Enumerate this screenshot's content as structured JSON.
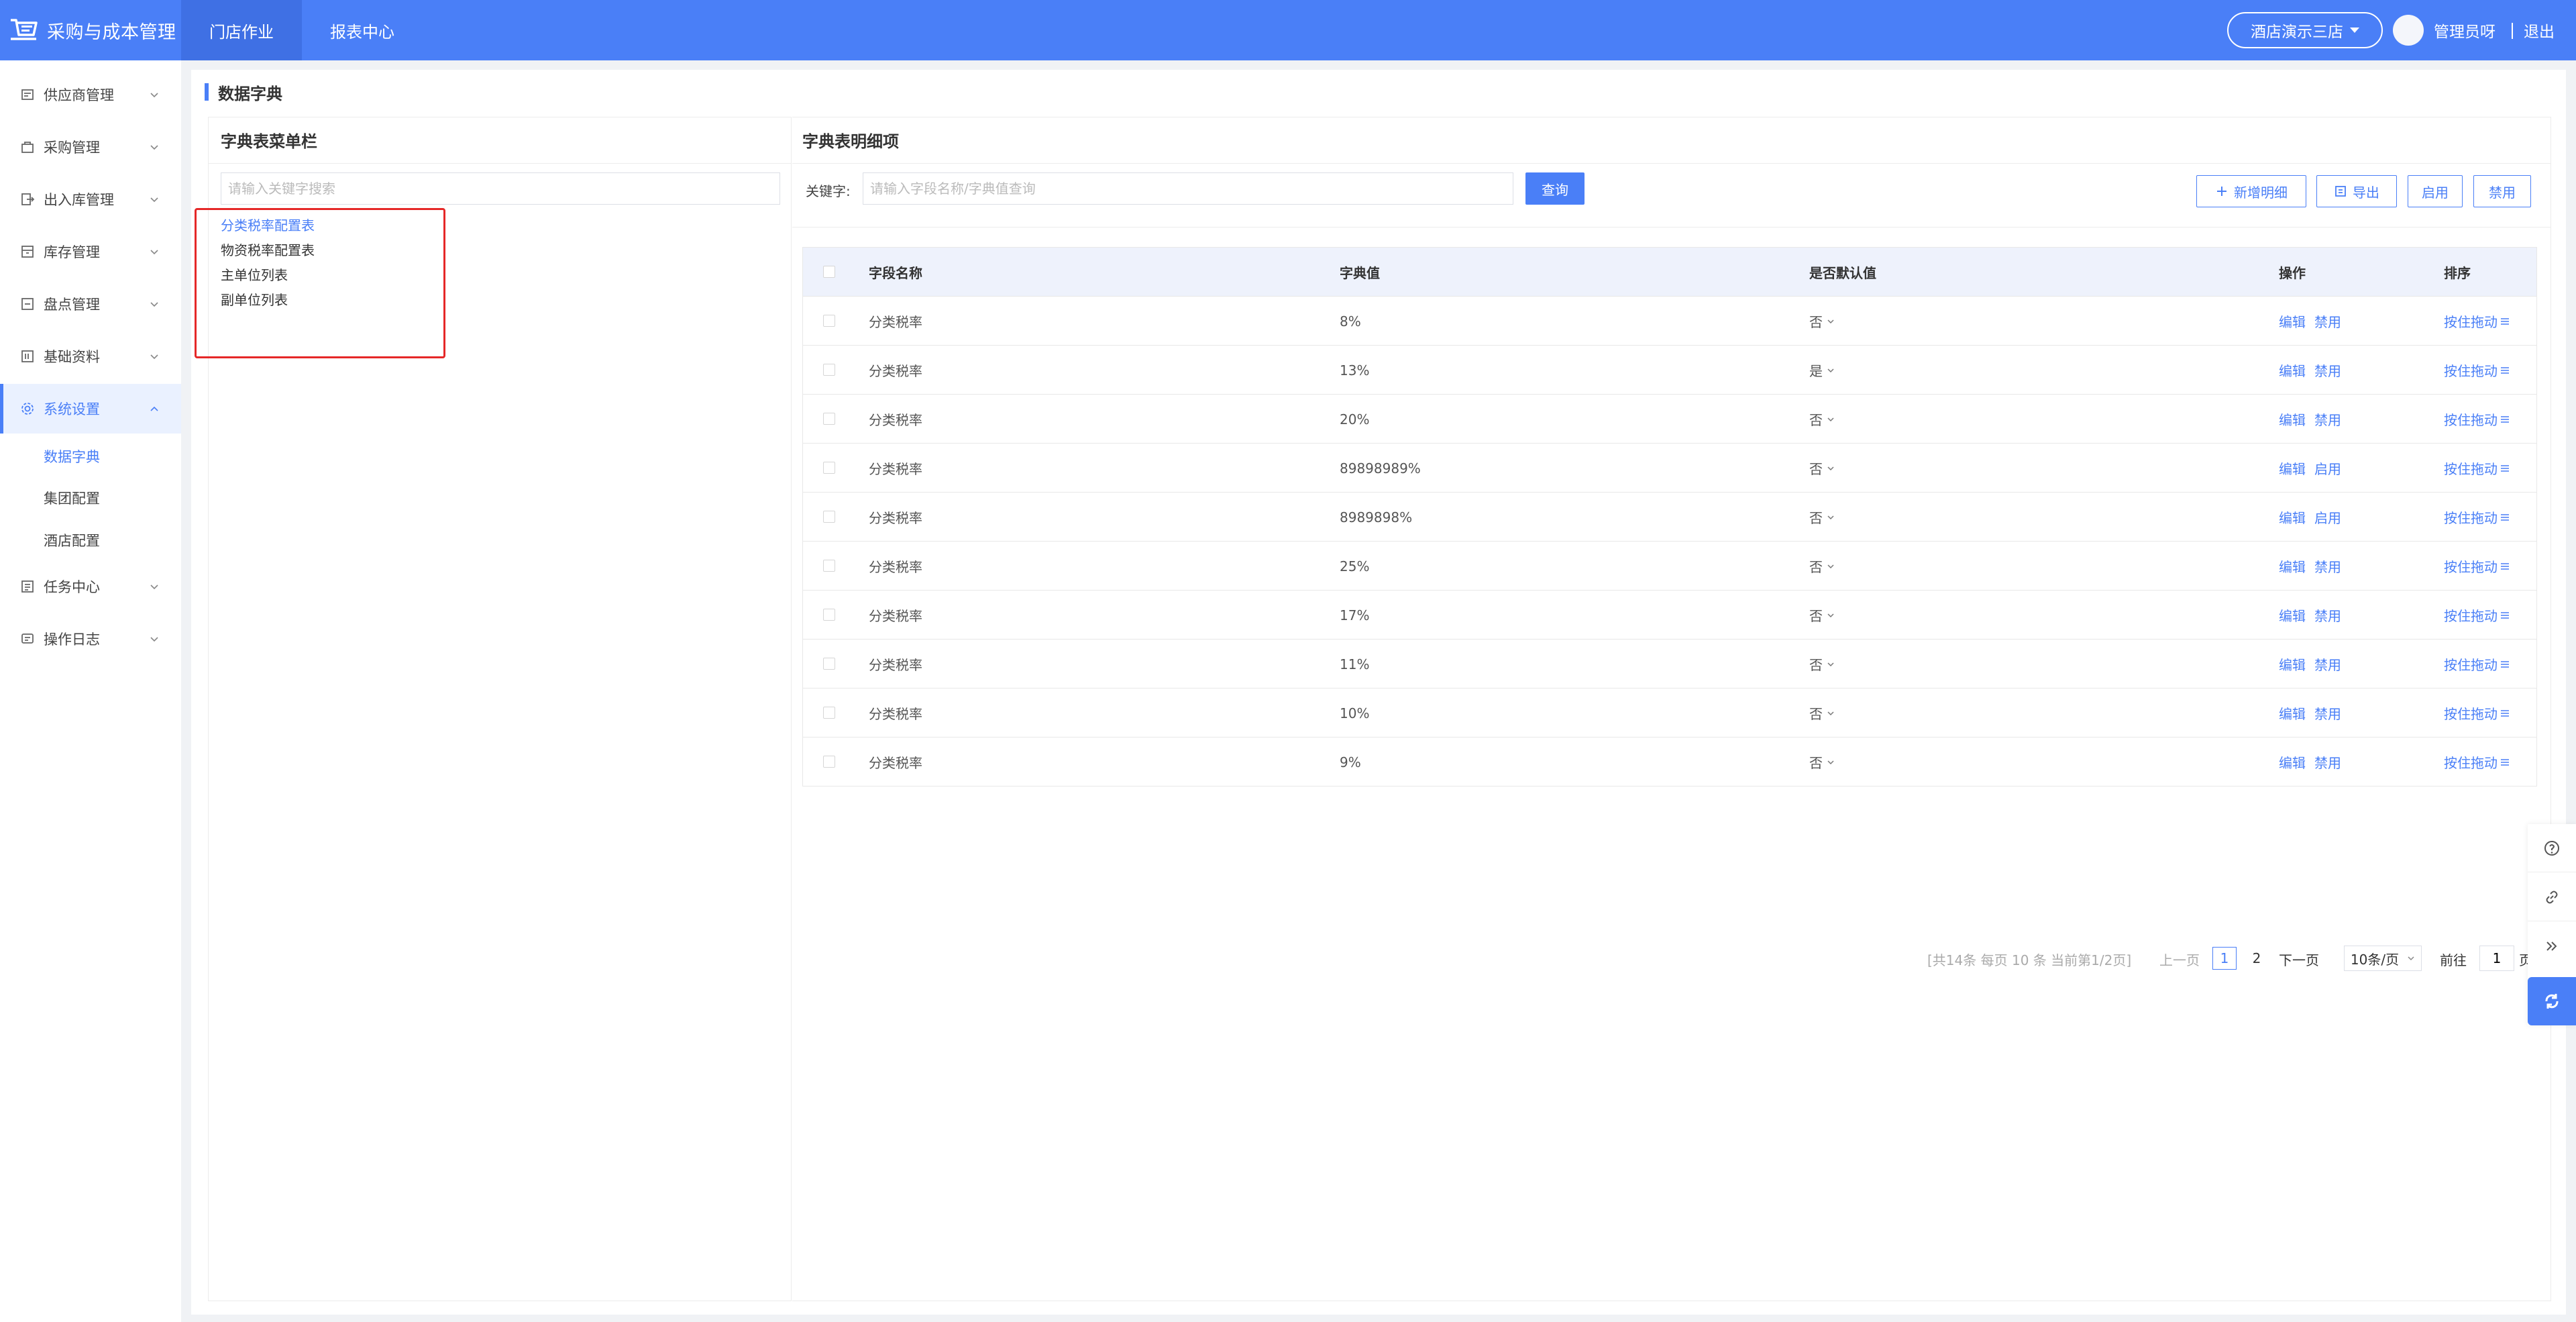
{
  "header": {
    "app_title": "采购与成本管理",
    "nav": [
      "门店作业",
      "报表中心"
    ],
    "store_select": "酒店演示三店",
    "user_name": "管理员呀",
    "separator": "|",
    "logout": "退出"
  },
  "sidebar": {
    "items": [
      {
        "label": "供应商管理",
        "icon": "supplier-icon"
      },
      {
        "label": "采购管理",
        "icon": "purchase-icon"
      },
      {
        "label": "出入库管理",
        "icon": "inout-icon"
      },
      {
        "label": "库存管理",
        "icon": "inventory-icon"
      },
      {
        "label": "盘点管理",
        "icon": "stocktake-icon"
      },
      {
        "label": "基础资料",
        "icon": "basic-data-icon"
      },
      {
        "label": "系统设置",
        "icon": "gear-icon"
      },
      {
        "label": "任务中心",
        "icon": "task-icon"
      },
      {
        "label": "操作日志",
        "icon": "log-icon"
      }
    ],
    "sub_items": [
      "数据字典",
      "集团配置",
      "酒店配置"
    ],
    "active_color": "#4a7ff7"
  },
  "page": {
    "title": "数据字典"
  },
  "left_panel": {
    "title": "字典表菜单栏",
    "search_placeholder": "请输入关键字搜索",
    "items": [
      "分类税率配置表",
      "物资税率配置表",
      "主单位列表",
      "副单位列表"
    ]
  },
  "right_panel": {
    "title": "字典表明细项",
    "keyword_label": "关键字:",
    "search_placeholder": "请输入字段名称/字典值查询",
    "query_button": "查询",
    "buttons": {
      "add": "新增明细",
      "export": "导出",
      "enable": "启用",
      "disable": "禁用"
    },
    "columns": [
      "字段名称",
      "字典值",
      "是否默认值",
      "操作",
      "排序"
    ],
    "rows": [
      {
        "name": "分类税率",
        "value": "8%",
        "default": "否",
        "edit": "编辑",
        "toggle": "禁用",
        "sort": "按住拖动"
      },
      {
        "name": "分类税率",
        "value": "13%",
        "default": "是",
        "edit": "编辑",
        "toggle": "禁用",
        "sort": "按住拖动"
      },
      {
        "name": "分类税率",
        "value": "20%",
        "default": "否",
        "edit": "编辑",
        "toggle": "禁用",
        "sort": "按住拖动"
      },
      {
        "name": "分类税率",
        "value": "89898989%",
        "default": "否",
        "edit": "编辑",
        "toggle": "启用",
        "sort": "按住拖动"
      },
      {
        "name": "分类税率",
        "value": "8989898%",
        "default": "否",
        "edit": "编辑",
        "toggle": "启用",
        "sort": "按住拖动"
      },
      {
        "name": "分类税率",
        "value": "25%",
        "default": "否",
        "edit": "编辑",
        "toggle": "禁用",
        "sort": "按住拖动"
      },
      {
        "name": "分类税率",
        "value": "17%",
        "default": "否",
        "edit": "编辑",
        "toggle": "禁用",
        "sort": "按住拖动"
      },
      {
        "name": "分类税率",
        "value": "11%",
        "default": "否",
        "edit": "编辑",
        "toggle": "禁用",
        "sort": "按住拖动"
      },
      {
        "name": "分类税率",
        "value": "10%",
        "default": "否",
        "edit": "编辑",
        "toggle": "禁用",
        "sort": "按住拖动"
      },
      {
        "name": "分类税率",
        "value": "9%",
        "default": "否",
        "edit": "编辑",
        "toggle": "禁用",
        "sort": "按住拖动"
      }
    ],
    "pagination": {
      "info": "[共14条 每页 10 条 当前第1/2页]",
      "prev": "上一页",
      "pages": [
        "1",
        "2"
      ],
      "current_page": "1",
      "next": "下一页",
      "page_size": "10条/页",
      "goto_label": "前往",
      "goto_value": "1",
      "goto_unit": "页"
    }
  },
  "float_tools": [
    "help-icon",
    "link-icon",
    "double-chevron-icon",
    "refresh-icon"
  ]
}
